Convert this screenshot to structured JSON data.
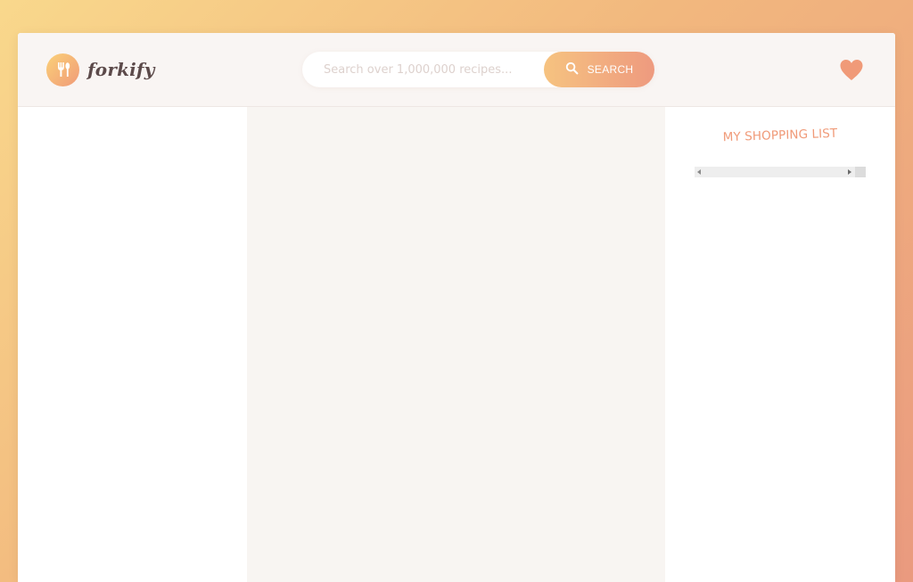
{
  "app": {
    "name": "forkify",
    "colors": {
      "accent_start": "#fbdb89",
      "accent_end": "#f48982",
      "header_bg": "#f9f5f3",
      "recipe_bg": "#f8f5f2",
      "heart": "#f09a78",
      "title": "#f09a78"
    }
  },
  "header": {
    "logo_icon": "fork-knife-icon",
    "search": {
      "placeholder": "Search over 1,000,000 recipes...",
      "value": "",
      "button_label": "SEARCH",
      "button_icon": "search-icon"
    },
    "likes_icon": "heart-icon"
  },
  "shopping": {
    "title": "MY SHOPPING LIST",
    "items": []
  },
  "results": {
    "items": []
  },
  "recipe": {}
}
